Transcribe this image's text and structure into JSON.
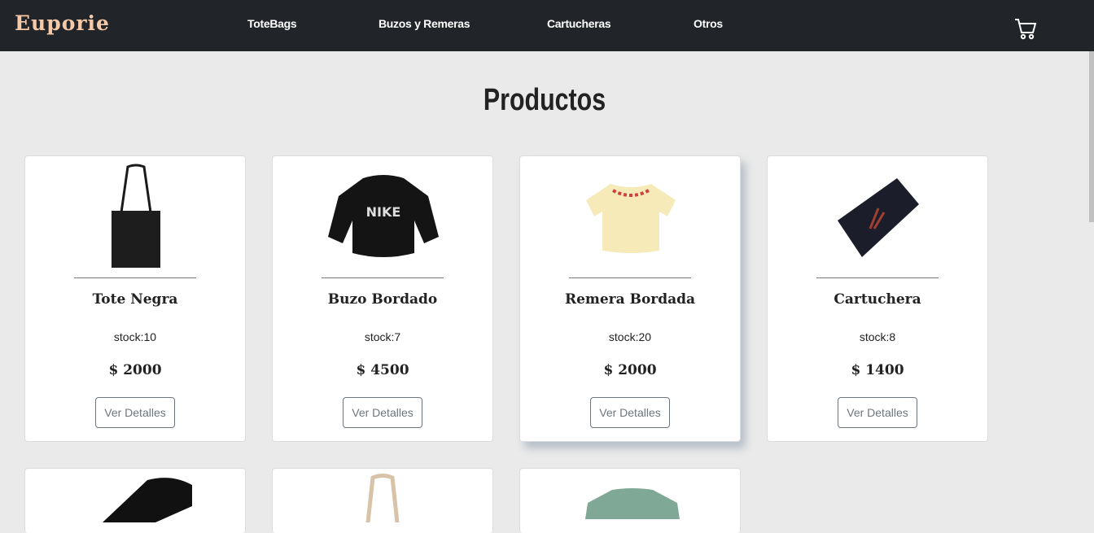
{
  "brand": "Euporie",
  "nav": [
    "ToteBags",
    "Buzos y Remeras",
    "Cartucheras",
    "Otros"
  ],
  "page_title": "Productos",
  "products": [
    {
      "name": "Tote Negra",
      "stock": "stock:10",
      "price": "$ 2000",
      "button": "Ver Detalles"
    },
    {
      "name": "Buzo Bordado",
      "stock": "stock:7",
      "price": "$ 4500",
      "button": "Ver Detalles"
    },
    {
      "name": "Remera Bordada",
      "stock": "stock:20",
      "price": "$ 2000",
      "button": "Ver Detalles"
    },
    {
      "name": "Cartuchera",
      "stock": "stock:8",
      "price": "$ 1400",
      "button": "Ver Detalles"
    }
  ]
}
